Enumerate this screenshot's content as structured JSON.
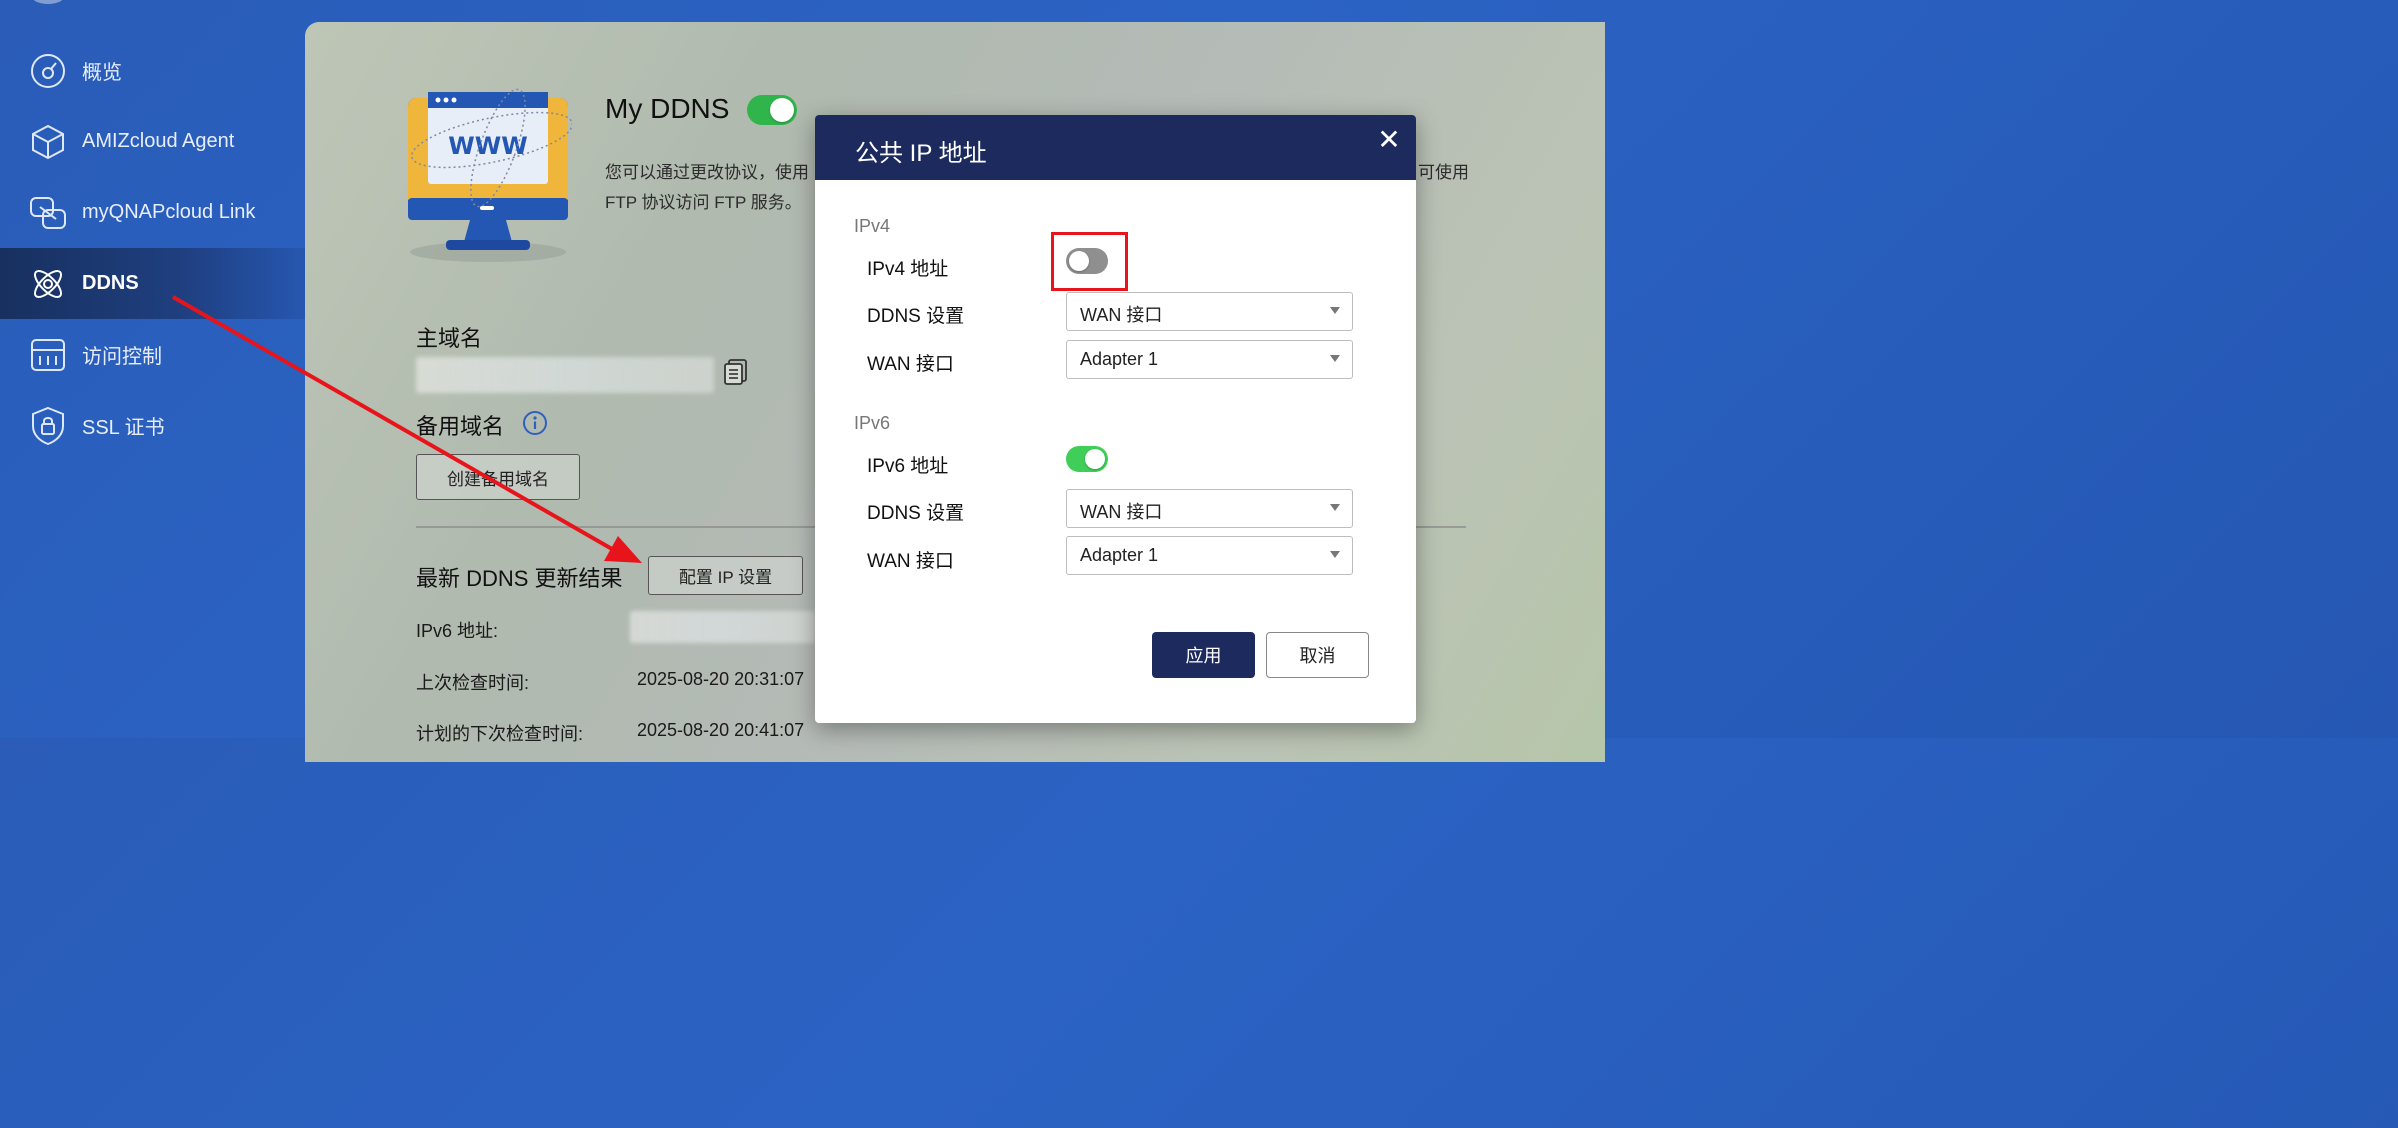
{
  "sidebar": {
    "items": [
      {
        "label": "概览",
        "icon": "gauge-icon"
      },
      {
        "label": "AMIZcloud Agent",
        "icon": "cube-icon"
      },
      {
        "label": "myQNAPcloud Link",
        "icon": "link-icon"
      },
      {
        "label": "DDNS",
        "icon": "atom-icon",
        "active": true
      },
      {
        "label": "访问控制",
        "icon": "access-control-icon"
      },
      {
        "label": "SSL 证书",
        "icon": "lock-shield-icon"
      }
    ]
  },
  "main": {
    "title": "My DDNS",
    "ddns_enabled": true,
    "description_line1": "您可以通过更改协议，使用",
    "description_line1_tail": "可使用",
    "description_line2": "FTP 协议访问 FTP 服务。",
    "primary_domain_label": "主域名",
    "backup_domain_label": "备用域名",
    "create_backup_button": "创建备用域名",
    "results_title": "最新 DDNS 更新结果",
    "config_ip_button": "配置 IP 设置",
    "ipv6_address_label": "IPv6 地址:",
    "last_check_label": "上次检查时间:",
    "last_check_value": "2025-08-20 20:31:07",
    "next_check_label": "计划的下次检查时间:",
    "next_check_value": "2025-08-20 20:41:07"
  },
  "dialog": {
    "title": "公共 IP 地址",
    "close_label": "✕",
    "ipv4": {
      "group_label": "IPv4",
      "address_label": "IPv4 地址",
      "enabled": false,
      "ddns_label": "DDNS 设置",
      "ddns_value": "WAN 接口",
      "wan_label": "WAN 接口",
      "wan_value": "Adapter 1"
    },
    "ipv6": {
      "group_label": "IPv6",
      "address_label": "IPv6 地址",
      "enabled": true,
      "ddns_label": "DDNS 设置",
      "ddns_value": "WAN 接口",
      "wan_label": "WAN 接口",
      "wan_value": "Adapter 1"
    },
    "apply_label": "应用",
    "cancel_label": "取消"
  },
  "colors": {
    "sidebar_bg": "#2a5cb8",
    "dialog_header": "#1d2a5e",
    "toggle_on": "#30b54c",
    "toggle_off": "#8f8f8f",
    "highlight": "#e8141c"
  }
}
